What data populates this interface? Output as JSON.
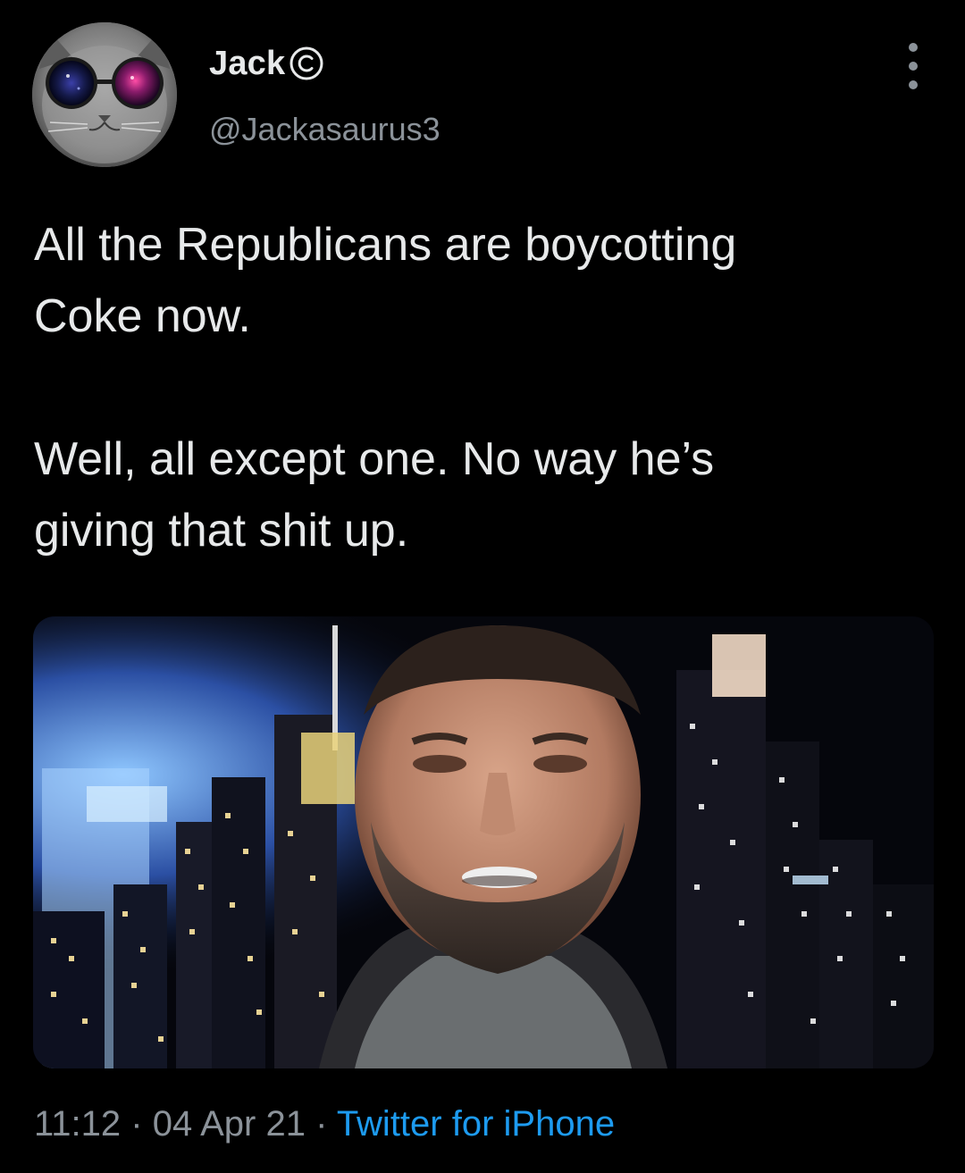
{
  "tweet": {
    "author": {
      "display_name": "Jack",
      "handle": "@Jackasaurus3",
      "badge_icon": "copyright-icon",
      "avatar_icon": "cat-with-glasses-avatar"
    },
    "text_line_1": "All the Republicans are boycotting\nCoke now.",
    "text_line_2": "Well, all except one. No way he’s\ngiving that shit up.",
    "media": {
      "description_icon": "photo-city-night-man"
    },
    "meta": {
      "time": "11:12",
      "separator": "·",
      "date": "04 Apr 21",
      "source": "Twitter for iPhone"
    },
    "menu_icon": "more-vertical-icon"
  },
  "colors": {
    "background": "#000000",
    "primary_text": "#e7e9ea",
    "secondary_text": "#8b9299",
    "link": "#1d9bf0"
  }
}
